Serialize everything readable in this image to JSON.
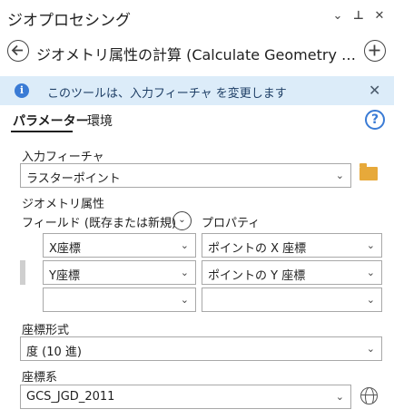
{
  "pane": {
    "title": "ジオプロセシング",
    "controls": [
      "⌄",
      "⊥",
      "✕"
    ]
  },
  "tool": {
    "back_icon": "←",
    "title": "ジオメトリ属性の計算 (Calculate Geometry Attributes)",
    "add_icon": "+"
  },
  "info": {
    "icon": "i",
    "message": "このツールは、入力フィーチャ を変更します",
    "close": "✕"
  },
  "tabs": {
    "parameters": "パラメーター",
    "environments": "環境",
    "help": "?"
  },
  "input_features": {
    "label": "入力フィーチャ",
    "value": "ラスターポイント"
  },
  "geometry_attributes": {
    "label": "ジオメトリ属性",
    "field_header": "フィールド (既存または新規)",
    "property_header": "プロパティ",
    "rows": [
      {
        "field": "X座標",
        "property": "ポイントの X 座標"
      },
      {
        "field": "Y座標",
        "property": "ポイントの Y 座標"
      },
      {
        "field": "",
        "property": ""
      }
    ]
  },
  "coordinate_format": {
    "label": "座標形式",
    "value": "度 (10 進)"
  },
  "coordinate_system": {
    "label": "座標系",
    "value": "GCS_JGD_2011"
  },
  "chevron": "⌄",
  "colors": {
    "accent": "#3a7bd5",
    "info_bg": "#dcecf9",
    "folder": "#e7a93a"
  }
}
